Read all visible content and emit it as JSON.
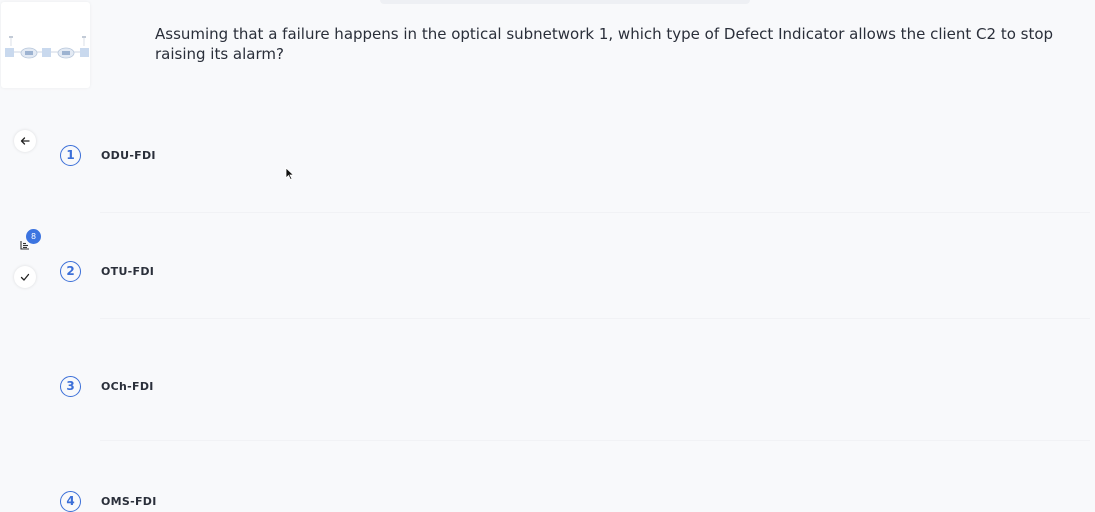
{
  "question": {
    "text": "Assuming that a failure happens in the optical subnetwork 1, which type of Defect Indicator allows the client C2 to stop raising its alarm?"
  },
  "rail": {
    "back_icon": "arrow-left-icon",
    "list_icon": "list-icon",
    "badge_count": "8",
    "check_icon": "check-icon"
  },
  "options": [
    {
      "number": "1",
      "label": "ODU-FDI"
    },
    {
      "number": "2",
      "label": "OTU-FDI"
    },
    {
      "number": "3",
      "label": "OCh-FDI"
    },
    {
      "number": "4",
      "label": "OMS-FDI"
    }
  ],
  "colors": {
    "accent": "#3b6fd8",
    "badge": "#3c74e0",
    "background": "#f8f9fb"
  }
}
